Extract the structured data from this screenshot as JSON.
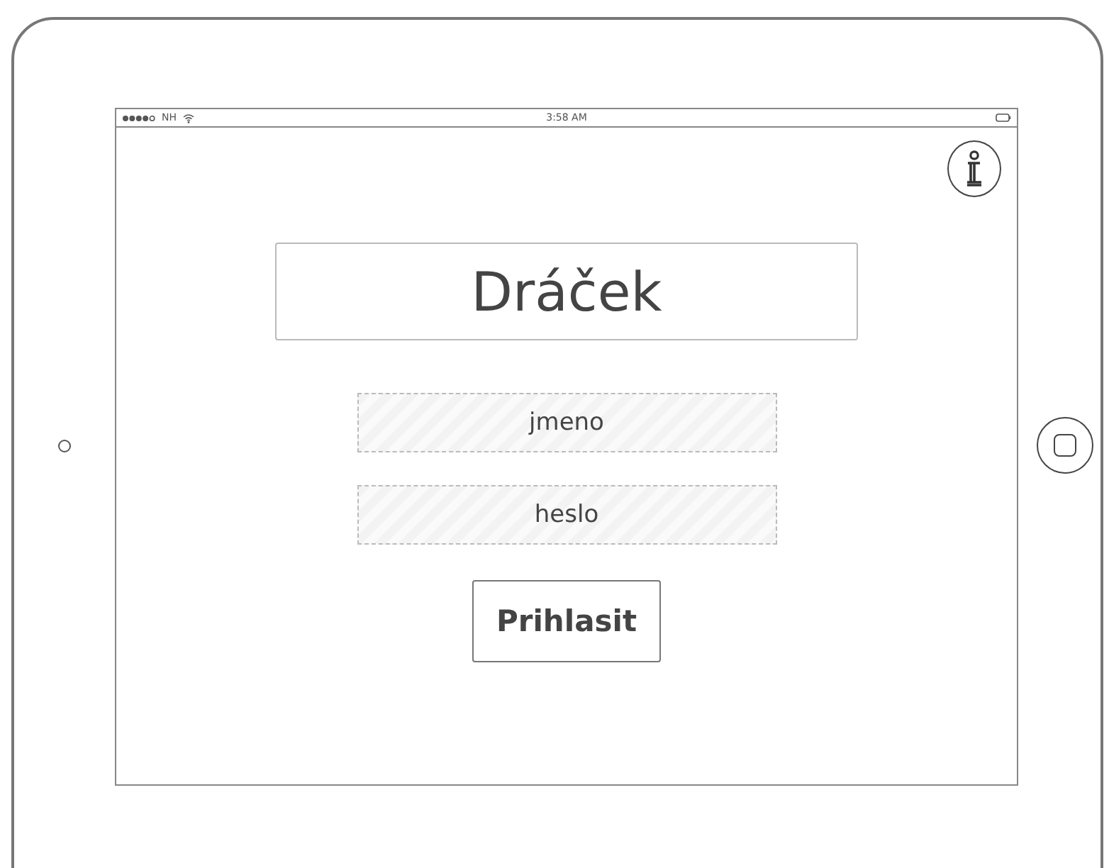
{
  "status_bar": {
    "carrier": "NH",
    "time": "3:58 AM"
  },
  "title": "Dráček",
  "fields": [
    {
      "placeholder": "jmeno"
    },
    {
      "placeholder": "heslo"
    }
  ],
  "buttons": [
    "Prihlasit"
  ]
}
